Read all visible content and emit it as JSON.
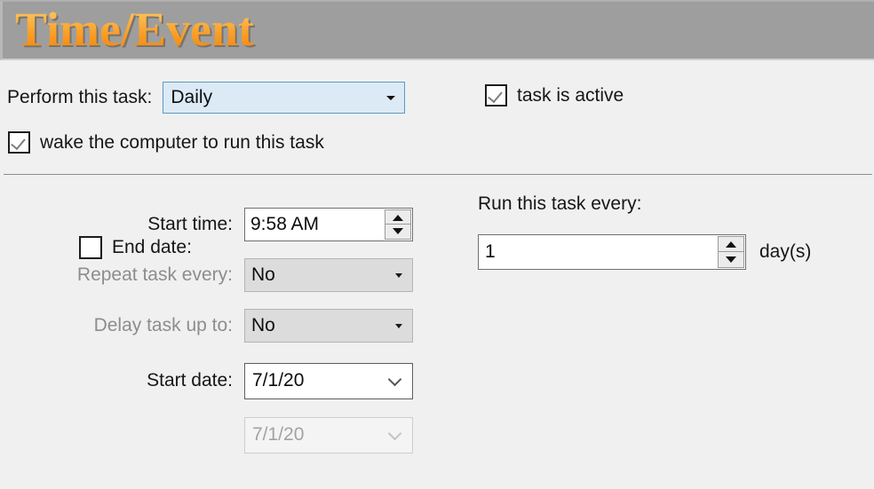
{
  "header": {
    "title": "Time/Event"
  },
  "perform": {
    "label": "Perform this task:",
    "selected": "Daily",
    "arrow_icon": "chevron-down-icon"
  },
  "checkboxes": {
    "task_active": {
      "label": "task is active",
      "checked": true
    },
    "wake_computer": {
      "label": "wake the computer to run this task",
      "checked": true
    },
    "end_date": {
      "label": "End date:",
      "checked": false
    }
  },
  "left_form": {
    "start_time": {
      "label": "Start time:",
      "value": "9:58 AM",
      "disabled": false
    },
    "repeat_task": {
      "label": "Repeat task every:",
      "value": "No",
      "disabled": true
    },
    "delay_task": {
      "label": "Delay task up to:",
      "value": "No",
      "disabled": true
    },
    "start_date": {
      "label": "Start date:",
      "value": "7/1/20",
      "disabled": false
    },
    "end_date": {
      "value": "7/1/20",
      "disabled": true
    }
  },
  "right_form": {
    "title": "Run this task every:",
    "interval_value": "1",
    "unit_label": "day(s)"
  },
  "icons": {
    "spinner_up": "triangle-up-icon",
    "spinner_down": "triangle-down-icon",
    "calendar_chevron": "chevron-down-icon",
    "checkmark": "check-icon"
  },
  "colors": {
    "banner_bg": "#9e9e9e",
    "title_gradient_top": "#fdd07a",
    "title_gradient_bottom": "#e07a06",
    "page_bg": "#f0f0f0",
    "focus_combo_bg": "#dbeaf5",
    "focus_combo_border": "#5b9ac2",
    "disabled_text": "#8d8d8d"
  }
}
